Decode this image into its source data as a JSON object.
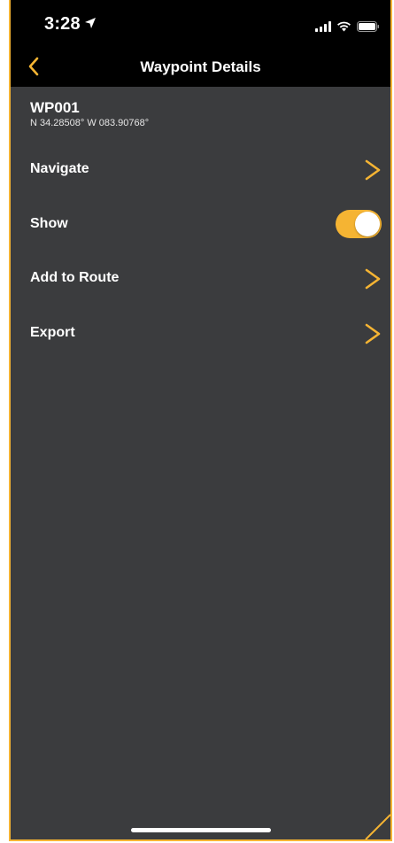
{
  "status_bar": {
    "time": "3:28",
    "location_icon": "location-arrow-icon",
    "signal_icon": "cellular-signal-icon",
    "wifi_icon": "wifi-icon",
    "battery_icon": "battery-icon"
  },
  "nav": {
    "back_icon": "chevron-left-icon",
    "title": "Waypoint Details"
  },
  "waypoint": {
    "name": "WP001",
    "coordinates": "N 34.28508°  W 083.90768°"
  },
  "menu": {
    "navigate": {
      "label": "Navigate",
      "icon": "chevron-right-icon"
    },
    "show": {
      "label": "Show",
      "toggle_on": true
    },
    "add_to_route": {
      "label": "Add to Route",
      "icon": "chevron-right-icon"
    },
    "export": {
      "label": "Export",
      "icon": "chevron-right-icon"
    }
  },
  "colors": {
    "accent": "#f5b433",
    "background": "#3b3c3e",
    "bar": "#000000",
    "text": "#ffffff"
  }
}
